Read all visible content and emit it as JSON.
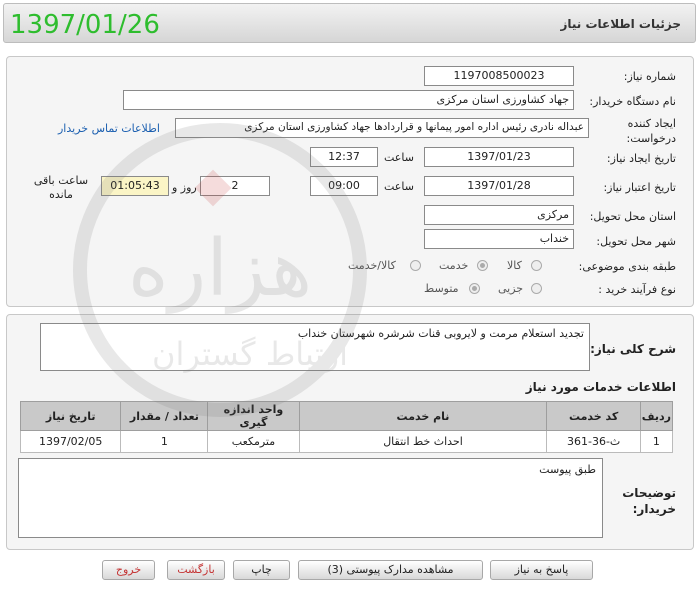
{
  "header": {
    "title": "جزئیات اطلاعات نیاز",
    "date": "1397/01/26"
  },
  "form": {
    "need_number_label": "شماره نیاز:",
    "need_number": "1197008500023",
    "buyer_label": "نام دستگاه خریدار:",
    "buyer": "جهاد کشاورزی استان مرکزی",
    "creator_label": "ایجاد کننده درخواست:",
    "creator": "عبداله نادری رئیس اداره امور پیمانها و قراردادها جهاد کشاورزی استان مرکزی",
    "contact_link": "اطلاعات تماس خریدار",
    "created_date_label": "تاریخ ایجاد نیاز:",
    "created_date": "1397/01/23",
    "hour_label": "ساعت",
    "created_time": "12:37",
    "validity_label": "تاریخ اعتبار نیاز:",
    "validity_date": "1397/01/28",
    "validity_time": "09:00",
    "days": "2",
    "days_label": "روز و",
    "remaining": "01:05:43",
    "remaining_label": "ساعت باقی مانده",
    "province_label": "استان محل تحویل:",
    "province": "مرکزی",
    "city_label": "شهر محل تحویل:",
    "city": "خنداب",
    "category_label": "طبقه بندی موضوعی:",
    "category_options": [
      "کالا",
      "خدمت",
      "کالا/خدمت"
    ],
    "category_selected": "خدمت",
    "purchase_label": "نوع فرآیند خرید :",
    "purchase_options": [
      "جزیی",
      "متوسط"
    ],
    "purchase_selected": "متوسط"
  },
  "description": {
    "label": "شرح کلی نیاز:",
    "text": "تجدید استعلام مرمت و لایروبی قنات شرشره شهرستان خنداب"
  },
  "services": {
    "title": "اطلاعات خدمات مورد نیاز",
    "columns": [
      "ردیف",
      "کد خدمت",
      "نام خدمت",
      "واحد اندازه گیری",
      "تعداد / مقدار",
      "تاریخ نیاز"
    ],
    "rows": [
      [
        "1",
        "ث-36-361",
        "احداث خط انتقال",
        "مترمکعب",
        "1",
        "1397/02/05"
      ]
    ]
  },
  "notes": {
    "label": "توضیحات خریدار:",
    "text": "طبق پیوست"
  },
  "buttons": {
    "reply": "پاسخ به نیاز",
    "attachments": "مشاهده مدارک پیوستی (3)",
    "print": "چاپ",
    "back": "بازگشت",
    "exit": "خروج"
  },
  "watermark": {
    "text": "هزاره",
    "subtext": "ارتباط گستران"
  },
  "colors": {
    "date_green": "#2ebd2e",
    "link_blue": "#1b5fb0",
    "exit_red": "#c43333",
    "timer_yellow": "#fbf5c6"
  }
}
